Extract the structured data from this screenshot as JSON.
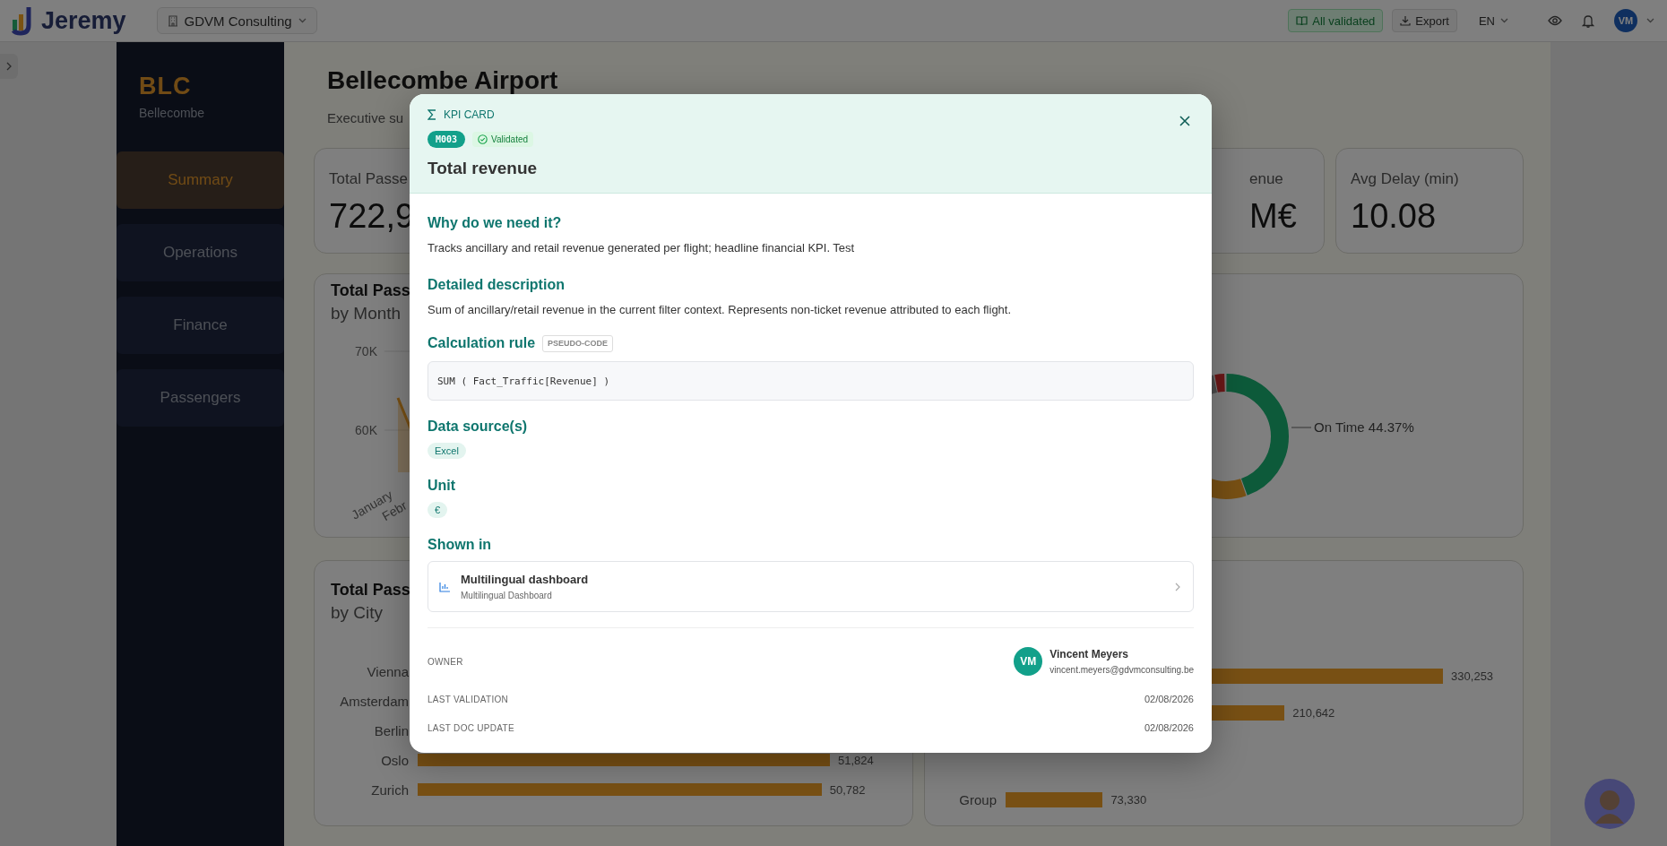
{
  "app": {
    "logo": "Jeremy",
    "organization": "GDVM Consulting",
    "validation_button": "All validated",
    "export_button": "Export",
    "language": "EN",
    "user_initials": "VM"
  },
  "sidebar": {
    "code": "BLC",
    "name": "Bellecombe",
    "items": [
      {
        "label": "Summary",
        "selected": true
      },
      {
        "label": "Operations",
        "selected": false
      },
      {
        "label": "Finance",
        "selected": false
      },
      {
        "label": "Passengers",
        "selected": false
      }
    ]
  },
  "page": {
    "title": "Bellecombe Airport",
    "subtitle": "Executive su"
  },
  "kpis": [
    {
      "label": "Total Passe",
      "value": "722,9"
    },
    {
      "label": "enue",
      "value": "M€"
    },
    {
      "label": "Avg Delay (min)",
      "value": "10.08"
    }
  ],
  "month_chart": {
    "title": "Total Pass",
    "subtitle": "by Month",
    "y_ticks": [
      "70K",
      "60K"
    ],
    "x_labels": [
      "January",
      "Febr"
    ]
  },
  "status_chart": {
    "label": "On Time 44.37%"
  },
  "city_chart": {
    "title": "Total Pass",
    "subtitle": "by City",
    "rows": [
      {
        "label": "Vienna"
      },
      {
        "label": "Amsterdam"
      },
      {
        "label": "Berlin"
      },
      {
        "label": "Oslo",
        "value": "51,824"
      },
      {
        "label": "Zurich",
        "value": "50,782"
      }
    ]
  },
  "type_chart": {
    "rows": [
      {
        "value": "330,253"
      },
      {
        "value": "210,642"
      },
      {
        "label": "Group",
        "value": "73,330"
      }
    ]
  },
  "modal": {
    "kind_label": "KPI CARD",
    "code": "M003",
    "status": "Validated",
    "title": "Total revenue",
    "sections": [
      {
        "heading": "Why do we need it?",
        "text": "Tracks ancillary and retail revenue generated per flight; headline financial KPI. Test"
      },
      {
        "heading": "Detailed description",
        "text": "Sum of ancillary/retail revenue in the current filter context. Represents non-ticket revenue attributed to each flight."
      }
    ],
    "calculation": {
      "heading": "Calculation rule",
      "tag": "PSEUDO-CODE",
      "code": "SUM ( Fact_Traffic[Revenue] )"
    },
    "data_sources": {
      "heading": "Data source(s)",
      "chips": [
        "Excel"
      ]
    },
    "unit": {
      "heading": "Unit",
      "chips": [
        "€"
      ]
    },
    "shown_in": {
      "heading": "Shown in",
      "items": [
        {
          "title": "Multilingual dashboard",
          "subtitle": "Multilingual Dashboard"
        }
      ]
    },
    "owner": {
      "label": "OWNER",
      "initials": "VM",
      "name": "Vincent Meyers",
      "email": "vincent.meyers@gdvmconsulting.be"
    },
    "dates": [
      {
        "label": "LAST VALIDATION",
        "value": "02/08/2026"
      },
      {
        "label": "LAST DOC UPDATE",
        "value": "02/08/2026"
      }
    ]
  }
}
